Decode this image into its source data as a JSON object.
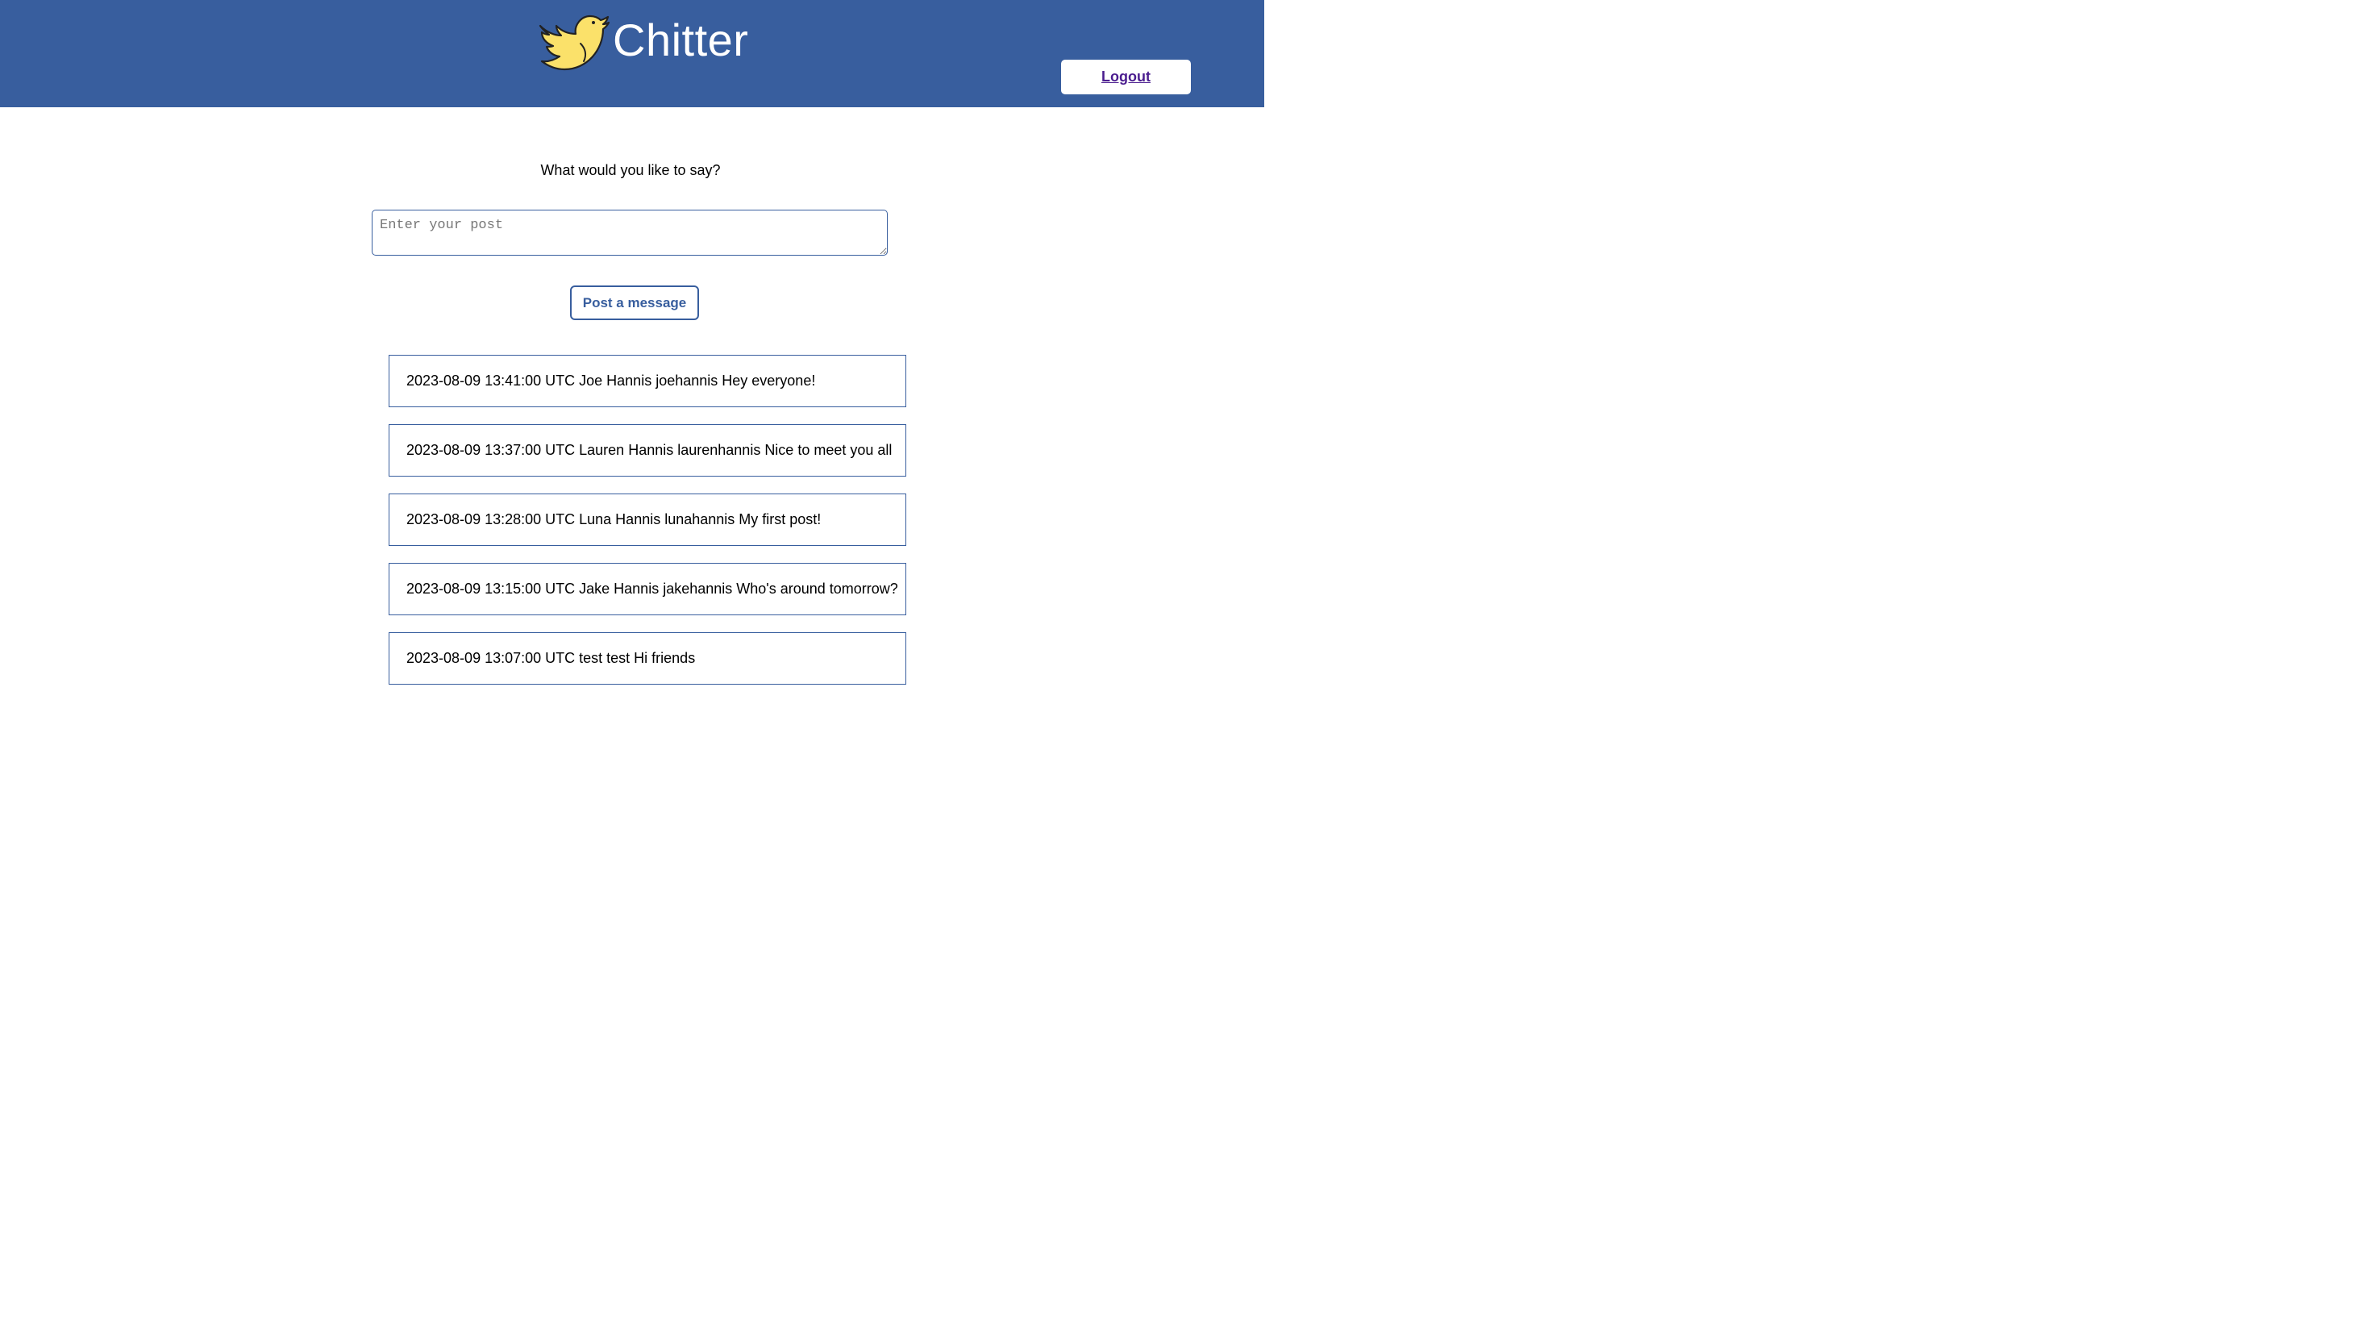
{
  "header": {
    "app_name": "Chitter",
    "logo_icon": "bird-icon",
    "logout_label": "Logout",
    "background_color": "#385e9e"
  },
  "composer": {
    "prompt": "What would you like to say?",
    "placeholder": "Enter your post",
    "value": "",
    "submit_label": "Post a message"
  },
  "peeps": [
    {
      "time": "2023-08-09 13:41:00 UTC",
      "name": "Joe Hannis",
      "username": "joehannis",
      "content": "Hey everyone!"
    },
    {
      "time": "2023-08-09 13:37:00 UTC",
      "name": "Lauren Hannis",
      "username": "laurenhannis",
      "content": "Nice to meet you all"
    },
    {
      "time": "2023-08-09 13:28:00 UTC",
      "name": "Luna Hannis",
      "username": "lunahannis",
      "content": "My first post!"
    },
    {
      "time": "2023-08-09 13:15:00 UTC",
      "name": "Jake Hannis",
      "username": "jakehannis",
      "content": "Who's around tomorrow?"
    },
    {
      "time": "2023-08-09 13:07:00 UTC",
      "name": "test",
      "username": "test",
      "content": "Hi friends"
    }
  ]
}
